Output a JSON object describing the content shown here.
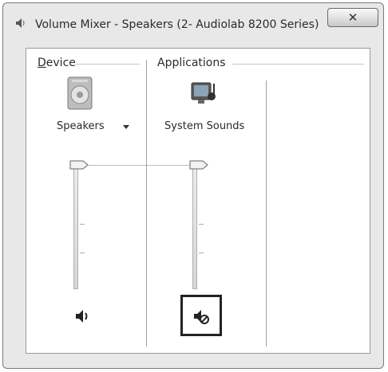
{
  "window": {
    "title": "Volume Mixer - Speakers (2- Audiolab 8200 Series)",
    "close_label": "✕"
  },
  "device": {
    "group_label_mnemonic": "D",
    "group_label_rest": "evice",
    "name": "Speakers",
    "volume_percent": 100,
    "muted": false
  },
  "applications": {
    "group_label": "Applications",
    "items": [
      {
        "name": "System Sounds",
        "volume_percent": 100,
        "muted": true
      }
    ]
  }
}
